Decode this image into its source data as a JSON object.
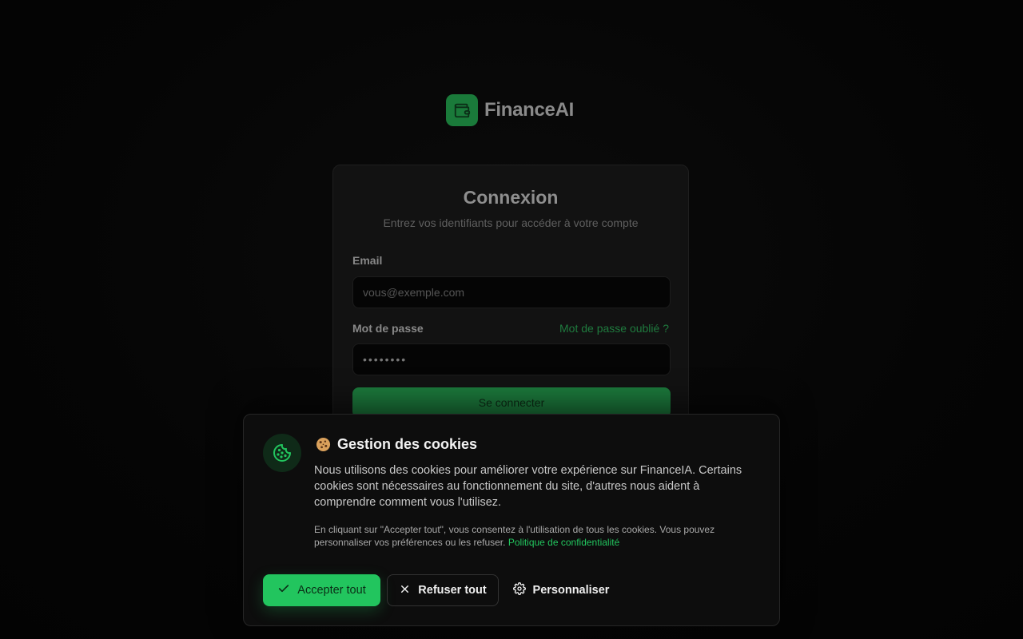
{
  "brand": {
    "name": "FinanceAI",
    "logo_icon": "wallet-icon",
    "color": "#1a7a3a"
  },
  "login": {
    "title": "Connexion",
    "subtitle": "Entrez vos identifiants pour accéder à votre compte",
    "email_label": "Email",
    "email_placeholder": "vous@exemple.com",
    "password_label": "Mot de passe",
    "forgot_link": "Mot de passe oublié ?",
    "password_value": "••••••••",
    "submit_label": "Se connecter",
    "accent": "#1c7a3c"
  },
  "cookie_banner": {
    "icon": "cookie-icon",
    "title": "Gestion des cookies",
    "title_emoji": "cookie-emoji",
    "description": "Nous utilisons des cookies pour améliorer votre expérience sur FinanceIA. Certains cookies sont nécessaires au fonctionnement du site, d'autres nous aident à comprendre comment vous l'utilisez.",
    "note": "En cliquant sur \"Accepter tout\", vous consentez à l'utilisation de tous les cookies. Vous pouvez personnaliser vos préférences ou les refuser.",
    "policy_link": "Politique de confidentialité",
    "accept_label": "Accepter tout",
    "accept_icon": "check-icon",
    "refuse_label": "Refuser tout",
    "refuse_icon": "close-icon",
    "customize_label": "Personnaliser",
    "customize_icon": "gear-icon",
    "accent": "#22c55e"
  }
}
